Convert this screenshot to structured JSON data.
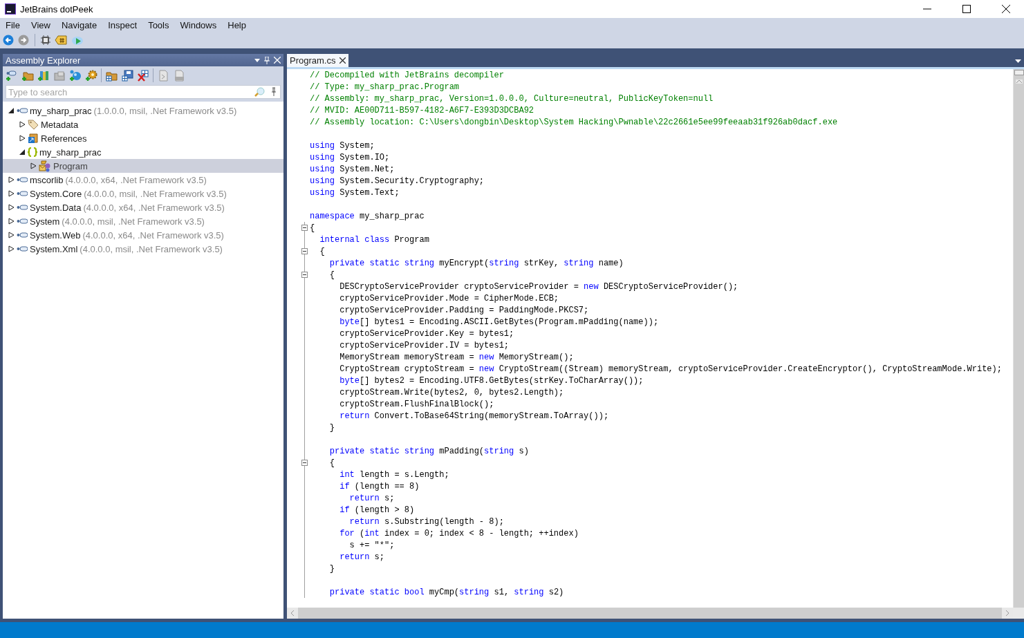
{
  "window": {
    "title": "JetBrains dotPeek"
  },
  "menu": [
    "File",
    "View",
    "Navigate",
    "Inspect",
    "Tools",
    "Windows",
    "Help"
  ],
  "explorer": {
    "title": "Assembly Explorer",
    "search": {
      "placeholder": "Type to search"
    },
    "tree": [
      {
        "label": "my_sharp_prac",
        "detail": "(1.0.0.0, msil, .Net Framework v3.5)",
        "kind": "assembly",
        "expanded": true,
        "selected": false,
        "children": [
          {
            "label": "Metadata",
            "kind": "metadata",
            "expanded": false,
            "selected": false
          },
          {
            "label": "References",
            "kind": "references",
            "expanded": false,
            "selected": false
          },
          {
            "label": "my_sharp_prac",
            "kind": "namespace",
            "expanded": true,
            "selected": false,
            "children": [
              {
                "label": "Program",
                "kind": "class",
                "expanded": false,
                "selected": true
              }
            ]
          }
        ]
      },
      {
        "label": "mscorlib",
        "detail": "(4.0.0.0, x64, .Net Framework v3.5)",
        "kind": "assembly",
        "expanded": false,
        "selected": false
      },
      {
        "label": "System.Core",
        "detail": "(4.0.0.0, msil, .Net Framework v3.5)",
        "kind": "assembly",
        "expanded": false,
        "selected": false
      },
      {
        "label": "System.Data",
        "detail": "(4.0.0.0, x64, .Net Framework v3.5)",
        "kind": "assembly",
        "expanded": false,
        "selected": false
      },
      {
        "label": "System",
        "detail": "(4.0.0.0, msil, .Net Framework v3.5)",
        "kind": "assembly",
        "expanded": false,
        "selected": false
      },
      {
        "label": "System.Web",
        "detail": "(4.0.0.0, x64, .Net Framework v3.5)",
        "kind": "assembly",
        "expanded": false,
        "selected": false
      },
      {
        "label": "System.Xml",
        "detail": "(4.0.0.0, msil, .Net Framework v3.5)",
        "kind": "assembly",
        "expanded": false,
        "selected": false
      }
    ]
  },
  "editor": {
    "tabs": [
      {
        "label": "Program.cs",
        "selected": true
      }
    ],
    "lines": [
      {
        "fold": false,
        "parts": [
          {
            "kind": "comment",
            "text": "// Decompiled with JetBrains decompiler"
          }
        ]
      },
      {
        "fold": false,
        "parts": [
          {
            "kind": "comment",
            "text": "// Type: my_sharp_prac.Program"
          }
        ]
      },
      {
        "fold": false,
        "parts": [
          {
            "kind": "comment",
            "text": "// Assembly: my_sharp_prac, Version=1.0.0.0, Culture=neutral, PublicKeyToken=null"
          }
        ]
      },
      {
        "fold": false,
        "parts": [
          {
            "kind": "comment",
            "text": "// MVID: AE00D711-B597-4182-A6F7-E393D3DCBA92"
          }
        ]
      },
      {
        "fold": false,
        "parts": [
          {
            "kind": "comment",
            "text": "// Assembly location: C:\\Users\\dongbin\\Desktop\\System Hacking\\Pwnable\\22c2661e5ee99feeaab31f926ab0dacf.exe"
          }
        ]
      },
      {
        "fold": false
      },
      {
        "fold": false,
        "parts": [
          {
            "kind": "keyword",
            "text": "using"
          },
          {
            "kind": "plain",
            "text": " System;"
          }
        ]
      },
      {
        "fold": false,
        "parts": [
          {
            "kind": "keyword",
            "text": "using"
          },
          {
            "kind": "plain",
            "text": " System.IO;"
          }
        ]
      },
      {
        "fold": false,
        "parts": [
          {
            "kind": "keyword",
            "text": "using"
          },
          {
            "kind": "plain",
            "text": " System.Net;"
          }
        ]
      },
      {
        "fold": false,
        "parts": [
          {
            "kind": "keyword",
            "text": "using"
          },
          {
            "kind": "plain",
            "text": " System.Security.Cryptography;"
          }
        ]
      },
      {
        "fold": false,
        "parts": [
          {
            "kind": "keyword",
            "text": "using"
          },
          {
            "kind": "plain",
            "text": " System.Text;"
          }
        ]
      },
      {
        "fold": false
      },
      {
        "fold": false,
        "parts": [
          {
            "kind": "keyword",
            "text": "namespace"
          },
          {
            "kind": "plain",
            "text": " my_sharp_prac"
          }
        ]
      },
      {
        "fold": true,
        "parts": [
          {
            "kind": "plain",
            "text": "{"
          }
        ]
      },
      {
        "fold": false,
        "parts": [
          {
            "kind": "keyword",
            "text": "  internal class"
          },
          {
            "kind": "plain",
            "text": " Program"
          }
        ]
      },
      {
        "fold": true,
        "parts": [
          {
            "kind": "plain",
            "text": "  {"
          }
        ]
      },
      {
        "fold": false,
        "parts": [
          {
            "kind": "keyword",
            "text": "    private static string"
          },
          {
            "kind": "plain",
            "text": " myEncrypt("
          },
          {
            "kind": "keyword",
            "text": "string"
          },
          {
            "kind": "plain",
            "text": " strKey, "
          },
          {
            "kind": "keyword",
            "text": "string"
          },
          {
            "kind": "plain",
            "text": " name)"
          }
        ]
      },
      {
        "fold": true,
        "parts": [
          {
            "kind": "plain",
            "text": "    {"
          }
        ]
      },
      {
        "fold": false,
        "parts": [
          {
            "kind": "plain",
            "text": "      DESCryptoServiceProvider cryptoServiceProvider = "
          },
          {
            "kind": "keyword",
            "text": "new"
          },
          {
            "kind": "plain",
            "text": " DESCryptoServiceProvider();"
          }
        ]
      },
      {
        "fold": false,
        "parts": [
          {
            "kind": "plain",
            "text": "      cryptoServiceProvider.Mode = CipherMode.ECB;"
          }
        ]
      },
      {
        "fold": false,
        "parts": [
          {
            "kind": "plain",
            "text": "      cryptoServiceProvider.Padding = PaddingMode.PKCS7;"
          }
        ]
      },
      {
        "fold": false,
        "parts": [
          {
            "kind": "keyword",
            "text": "      byte"
          },
          {
            "kind": "plain",
            "text": "[] bytes1 = Encoding.ASCII.GetBytes(Program.mPadding(name));"
          }
        ]
      },
      {
        "fold": false,
        "parts": [
          {
            "kind": "plain",
            "text": "      cryptoServiceProvider.Key = bytes1;"
          }
        ]
      },
      {
        "fold": false,
        "parts": [
          {
            "kind": "plain",
            "text": "      cryptoServiceProvider.IV = bytes1;"
          }
        ]
      },
      {
        "fold": false,
        "parts": [
          {
            "kind": "plain",
            "text": "      MemoryStream memoryStream = "
          },
          {
            "kind": "keyword",
            "text": "new"
          },
          {
            "kind": "plain",
            "text": " MemoryStream();"
          }
        ]
      },
      {
        "fold": false,
        "parts": [
          {
            "kind": "plain",
            "text": "      CryptoStream cryptoStream = "
          },
          {
            "kind": "keyword",
            "text": "new"
          },
          {
            "kind": "plain",
            "text": " CryptoStream((Stream) memoryStream, cryptoServiceProvider.CreateEncryptor(), CryptoStreamMode.Write);"
          }
        ]
      },
      {
        "fold": false,
        "parts": [
          {
            "kind": "keyword",
            "text": "      byte"
          },
          {
            "kind": "plain",
            "text": "[] bytes2 = Encoding.UTF8.GetBytes(strKey.ToCharArray());"
          }
        ]
      },
      {
        "fold": false,
        "parts": [
          {
            "kind": "plain",
            "text": "      cryptoStream.Write(bytes2, 0, bytes2.Length);"
          }
        ]
      },
      {
        "fold": false,
        "parts": [
          {
            "kind": "plain",
            "text": "      cryptoStream.FlushFinalBlock();"
          }
        ]
      },
      {
        "fold": false,
        "parts": [
          {
            "kind": "keyword",
            "text": "      return"
          },
          {
            "kind": "plain",
            "text": " Convert.ToBase64String(memoryStream.ToArray());"
          }
        ]
      },
      {
        "fold": false,
        "parts": [
          {
            "kind": "plain",
            "text": "    }"
          }
        ]
      },
      {
        "fold": false
      },
      {
        "fold": false,
        "parts": [
          {
            "kind": "keyword",
            "text": "    private static string"
          },
          {
            "kind": "plain",
            "text": " mPadding("
          },
          {
            "kind": "keyword",
            "text": "string"
          },
          {
            "kind": "plain",
            "text": " s)"
          }
        ]
      },
      {
        "fold": true,
        "parts": [
          {
            "kind": "plain",
            "text": "    {"
          }
        ]
      },
      {
        "fold": false,
        "parts": [
          {
            "kind": "keyword",
            "text": "      int"
          },
          {
            "kind": "plain",
            "text": " length = s.Length;"
          }
        ]
      },
      {
        "fold": false,
        "parts": [
          {
            "kind": "keyword",
            "text": "      if"
          },
          {
            "kind": "plain",
            "text": " (length == 8)"
          }
        ]
      },
      {
        "fold": false,
        "parts": [
          {
            "kind": "keyword",
            "text": "        return"
          },
          {
            "kind": "plain",
            "text": " s;"
          }
        ]
      },
      {
        "fold": false,
        "parts": [
          {
            "kind": "keyword",
            "text": "      if"
          },
          {
            "kind": "plain",
            "text": " (length > 8)"
          }
        ]
      },
      {
        "fold": false,
        "parts": [
          {
            "kind": "keyword",
            "text": "        return"
          },
          {
            "kind": "plain",
            "text": " s.Substring(length - 8);"
          }
        ]
      },
      {
        "fold": false,
        "parts": [
          {
            "kind": "keyword",
            "text": "      for"
          },
          {
            "kind": "plain",
            "text": " ("
          },
          {
            "kind": "keyword",
            "text": "int"
          },
          {
            "kind": "plain",
            "text": " index = 0; index < 8 - length; ++index)"
          }
        ]
      },
      {
        "fold": false,
        "parts": [
          {
            "kind": "plain",
            "text": "        s += \"*\";"
          }
        ]
      },
      {
        "fold": false,
        "parts": [
          {
            "kind": "keyword",
            "text": "      return"
          },
          {
            "kind": "plain",
            "text": " s;"
          }
        ]
      },
      {
        "fold": false,
        "parts": [
          {
            "kind": "plain",
            "text": "    }"
          }
        ]
      },
      {
        "fold": false
      },
      {
        "fold": false,
        "parts": [
          {
            "kind": "keyword",
            "text": "    private static bool"
          },
          {
            "kind": "plain",
            "text": " myCmp("
          },
          {
            "kind": "keyword",
            "text": "string"
          },
          {
            "kind": "plain",
            "text": " s1, "
          },
          {
            "kind": "keyword",
            "text": "string"
          },
          {
            "kind": "plain",
            "text": " s2)"
          }
        ]
      }
    ]
  }
}
